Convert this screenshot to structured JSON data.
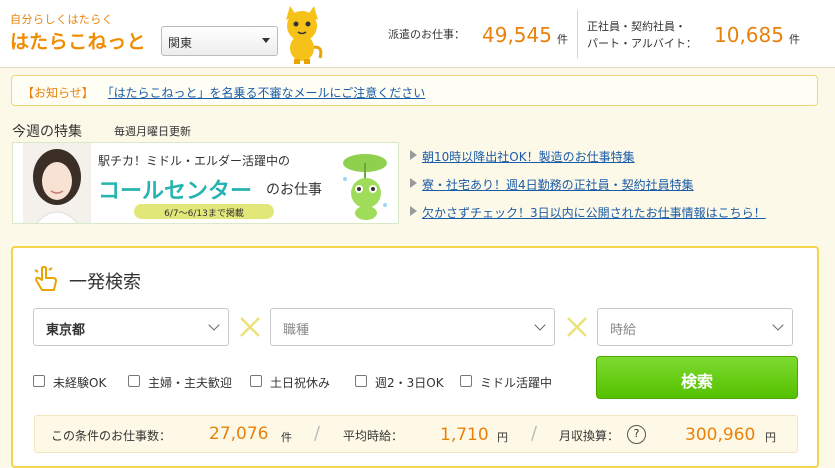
{
  "header": {
    "tagline": "自分らしくはたらく",
    "logo": "はたらこねっと",
    "region": "関東",
    "stats": {
      "dispatch_label": "派遣のお仕事：",
      "dispatch_count": "49,545",
      "dispatch_unit": "件",
      "other_label_line1": "正社員・契約社員・",
      "other_label_line2": "パート・アルバイト：",
      "other_count": "10,685",
      "other_unit": "件"
    }
  },
  "notice": {
    "tag": "【お知らせ】",
    "link": "「はたらこねっと」を名乗る不審なメールにご注意ください"
  },
  "features": {
    "title": "今週の特集",
    "subtitle": "毎週月曜日更新",
    "banner": {
      "line1": "駅チカ！ミドル・エルダー活躍中の",
      "line2": "コールセンター",
      "line2_suffix": "のお仕事",
      "dates": "6/7〜6/13まで掲載"
    },
    "links": [
      "朝10時以降出社OK！製造のお仕事特集",
      "寮・社宅あり！週4日勤務の正社員・契約社員特集",
      "欠かさずチェック！3日以内に公開されたお仕事情報はこちら！"
    ]
  },
  "search": {
    "title": "一発検索",
    "prefecture": "東京都",
    "job_type_placeholder": "職種",
    "wage_placeholder": "時給",
    "checkboxes": [
      "未経験OK",
      "主婦・主夫歓迎",
      "土日祝休み",
      "週2・3日OK",
      "ミドル活躍中"
    ],
    "button": "検索",
    "results": {
      "count_label": "この条件のお仕事数：",
      "count": "27,076",
      "count_unit": "件",
      "avg_label": "平均時給：",
      "avg": "1,710",
      "avg_unit": "円",
      "monthly_label": "月収換算：",
      "help": "?",
      "monthly": "300,960",
      "monthly_unit": "円"
    }
  },
  "colors": {
    "accent": "#e8820c",
    "link": "#1a5ca8",
    "panel_border": "#f4d44c",
    "button": "#54c000"
  }
}
